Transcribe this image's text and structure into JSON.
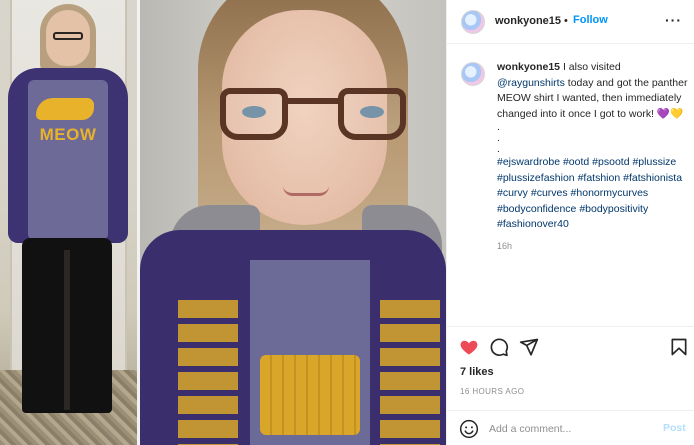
{
  "post": {
    "username": "wonkyone15",
    "dot": "•",
    "follow_label": "Follow",
    "more_label": "···",
    "caption": {
      "username": "wonkyone15",
      "text_1": " I also visited ",
      "mention": "@raygunshirts",
      "text_2": " today and got the panther MEOW shirt I wanted, then immediately changed into it once I got to work! 💜💛",
      "dots": [
        ".",
        ".",
        "."
      ],
      "hashtags": [
        "#ejswardrobe",
        "#ootd",
        "#psootd",
        "#plussize",
        "#plussizefashion",
        "#fatshion",
        "#fatshionista",
        "#curvy",
        "#curves",
        "#honormycurves",
        "#bodyconfidence",
        "#bodypositivity",
        "#fashionover40"
      ],
      "time": "16h"
    },
    "likes": "7 likes",
    "posted_ago": "16 HOURS AGO",
    "comment_placeholder": "Add a comment...",
    "post_label": "Post",
    "photo_shirt_text": "MEOW",
    "colors": {
      "follow": "#0095f6",
      "like_heart": "#ed4956",
      "hashtag": "#00376b",
      "post_disabled": "#b2dffc"
    },
    "icons": [
      "heart-icon",
      "comment-icon",
      "share-icon",
      "bookmark-icon",
      "emoji-icon",
      "more-icon"
    ]
  }
}
